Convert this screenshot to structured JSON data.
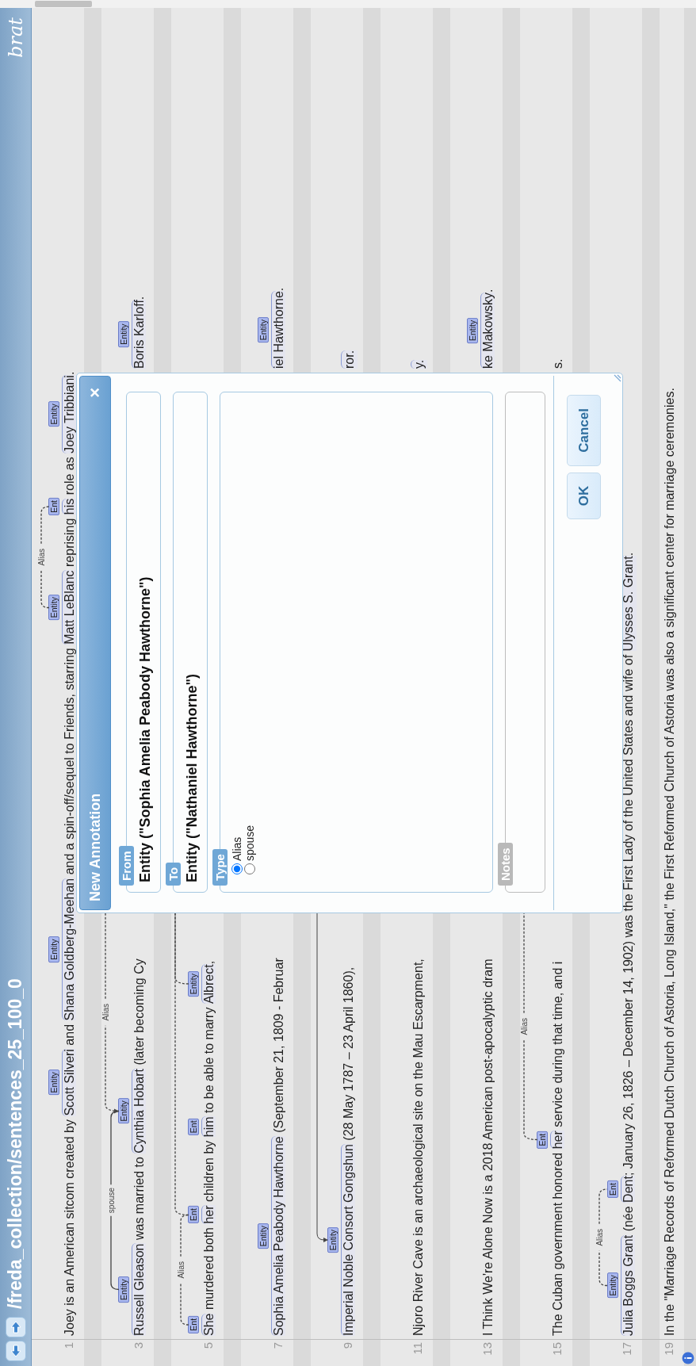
{
  "header": {
    "title": "/freda_collection/sentences_25_100_0",
    "logo": "brat"
  },
  "rows": [
    {
      "number": "1",
      "kind": "full",
      "fragments": [
        {
          "segments": [
            {
              "text": "Joey is an American sitcom created by "
            },
            {
              "text": "Scott Silveri",
              "label": "Entity"
            },
            {
              "text": " and "
            },
            {
              "text": "Shana Goldberg-Meehan",
              "label": "Entity"
            },
            {
              "text": " and a spin-off/sequel to Friends, starring "
            },
            {
              "text": "Matt LeBlanc",
              "label": "Entity",
              "arc": {
                "kind": "dashed",
                "to_edge": false,
                "label": "Alias"
              }
            },
            {
              "text": " reprising "
            },
            {
              "text": "his",
              "label": "Ent"
            },
            {
              "text": " role as "
            },
            {
              "text": "Joey Tribbiani",
              "label": "Entity"
            },
            {
              "text": "."
            }
          ]
        }
      ]
    },
    {
      "number": "3",
      "kind": "split",
      "fragments": [
        {
          "segments": [
            {
              "text": "Russell Gleason",
              "label": "Entity",
              "arc": {
                "kind": "arrow",
                "to_edge": false,
                "label": "spouse"
              }
            },
            {
              "text": " was married to "
            },
            {
              "text": "Cynthia Hobart",
              "label": "Entity",
              "arc": {
                "kind": "dashed",
                "to_edge": true,
                "label": "Alias"
              }
            },
            {
              "text": " (later becoming Cy"
            }
          ]
        },
        {
          "segments": [
            {
              "text": "Boris Karloff",
              "label": "Entity"
            },
            {
              "text": "."
            }
          ]
        }
      ]
    },
    {
      "number": "5",
      "kind": "split",
      "fragments": [
        {
          "segments": [
            {
              "text": "She",
              "label": "Ent",
              "arc": {
                "kind": "dashed",
                "to_edge": false,
                "label": "Alias"
              }
            },
            {
              "text": " murdered both "
            },
            {
              "text": "her",
              "label": "Ent",
              "arc": {
                "kind": "dashed",
                "to_edge": true
              }
            },
            {
              "text": " children by "
            },
            {
              "text": "him",
              "label": "Ent"
            },
            {
              "text": " to be able to marry "
            },
            {
              "text": "Albrect",
              "label": "Entity",
              "arc": {
                "kind": "dashed",
                "to_edge": true
              }
            },
            {
              "text": ","
            }
          ]
        }
      ]
    },
    {
      "number": "7",
      "kind": "split",
      "fragments": [
        {
          "segments": [
            {
              "text": "Sophia Amelia Peabody Hawthorne",
              "label": "Entity"
            },
            {
              "text": " (September 21, 1809 - Februar"
            }
          ]
        },
        {
          "segments": [
            {
              "text": "iel Hawthorne",
              "label": "Entity"
            },
            {
              "text": "."
            }
          ]
        }
      ]
    },
    {
      "number": "9",
      "kind": "split",
      "fragments": [
        {
          "segments": [
            {
              "text": "Imperial Noble Consort Gongshun",
              "label": "Entity",
              "incoming_arrow": true
            },
            {
              "text": " (28 May 1787 – 23 April 1860),"
            }
          ]
        },
        {
          "segments": [
            {
              "text": "ror.",
              "bracketed": true
            }
          ]
        }
      ]
    },
    {
      "number": "11",
      "kind": "split",
      "fragments": [
        {
          "segments": [
            {
              "text": "Njoro River Cave is an archaeological site on the Mau Escarpment,"
            }
          ]
        },
        {
          "segments": [
            {
              "text": "y.",
              "bracketed": true
            }
          ]
        }
      ]
    },
    {
      "number": "13",
      "kind": "split",
      "fragments": [
        {
          "segments": [
            {
              "text": "I Think We're Alone Now is a 2018 American post-apocalyptic dram"
            }
          ]
        },
        {
          "segments": [
            {
              "text": "ke Makowsky",
              "label": "Entity"
            },
            {
              "text": "."
            }
          ]
        }
      ]
    },
    {
      "number": "15",
      "kind": "split",
      "fragments": [
        {
          "segments": [
            {
              "text": "The Cuban government honored "
            },
            {
              "text": "her",
              "label": "Ent",
              "arc": {
                "kind": "dashed",
                "to_edge": true,
                "label": "Alias"
              }
            },
            {
              "text": " service during that time, and i"
            }
          ]
        },
        {
          "segments": [
            {
              "text": "s."
            }
          ]
        }
      ]
    },
    {
      "number": "17",
      "kind": "full",
      "fragments": [
        {
          "segments": [
            {
              "text": "Julia Boggs Grant",
              "label": "Entity",
              "arc": {
                "kind": "dashed",
                "to_edge": false,
                "label": "Alias"
              }
            },
            {
              "text": " (née "
            },
            {
              "text": "Dent",
              "label": "Ent"
            },
            {
              "text": "; January 26, 1826 – December 14, 1902) was the First Lady of the United States and wife of "
            },
            {
              "text": "Ulysses S. Grant",
              "bracketed": true
            },
            {
              "text": "."
            }
          ]
        }
      ]
    },
    {
      "number": "19",
      "kind": "full",
      "fragments": [
        {
          "segments": [
            {
              "text": "In the \"Marriage Records of Reformed Dutch Church of Astoria, Long Island,\" the First Reformed Church of Astoria was also a significant center for marriage ceremonies."
            }
          ]
        }
      ]
    }
  ],
  "dialog": {
    "title": "New Annotation",
    "close": "×",
    "fieldsets": [
      {
        "legend": "From",
        "kind": "text",
        "value": "Entity (\"Sophia Amelia Peabody Hawthorne\")"
      },
      {
        "legend": "To",
        "kind": "text",
        "value": "Entity (\"Nathaniel Hawthorne\")"
      },
      {
        "legend": "Type",
        "kind": "radios",
        "options": [
          {
            "label": "Alias",
            "selected": true
          },
          {
            "label": "spouse",
            "selected": false
          }
        ]
      },
      {
        "legend": "Notes",
        "kind": "input",
        "disabled": true
      }
    ],
    "buttons": [
      "OK",
      "Cancel"
    ]
  }
}
